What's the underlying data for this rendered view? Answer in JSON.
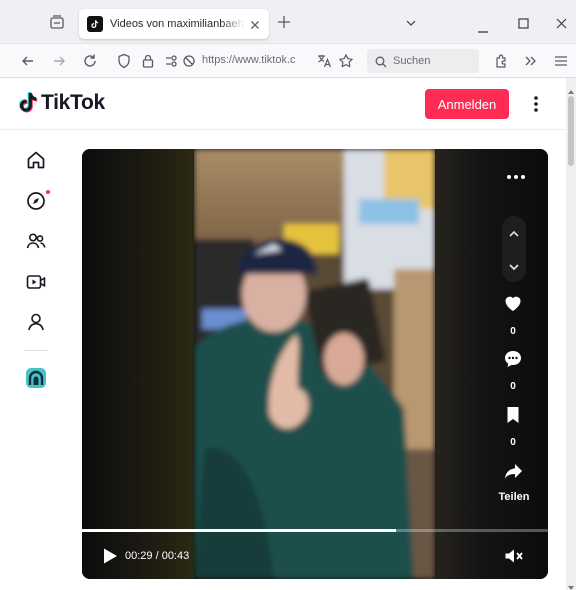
{
  "browser": {
    "tab": {
      "title": "Videos von maximilianbaehring"
    },
    "url": "https://www.tiktok.c",
    "search_placeholder": "Suchen"
  },
  "icons": {
    "tab_list": "tab-list-icon",
    "tab_close": "close-icon",
    "new_tab": "plus-icon",
    "minimize": "minimize-icon",
    "maximize": "maximize-icon",
    "window_close": "window-close-icon",
    "back": "arrow-left-icon",
    "forward": "arrow-right-icon",
    "reload": "reload-icon",
    "tracking_protection": "shield-icon",
    "lock": "lock-icon",
    "permissions": "permissions-icon",
    "translate": "translate-icon",
    "bookmark_star": "star-icon",
    "search": "search-icon",
    "extensions": "puzzle-icon",
    "overflow": "chevrons-right-icon",
    "menu": "hamburger-icon"
  },
  "tiktok": {
    "logo_text": "TikTok",
    "login_label": "Anmelden",
    "brand_colors": {
      "accent": "#fe2c55",
      "cyan": "#25f4ee"
    },
    "sidebar": [
      {
        "id": "home",
        "icon": "home-icon"
      },
      {
        "id": "explore",
        "icon": "compass-icon",
        "has_notification_dot": true
      },
      {
        "id": "following",
        "icon": "users-icon"
      },
      {
        "id": "live",
        "icon": "live-video-icon"
      },
      {
        "id": "profile",
        "icon": "user-icon"
      },
      {
        "id": "avatar",
        "icon": "creator-avatar-icon"
      }
    ],
    "video": {
      "actions": {
        "like_count": "0",
        "comment_count": "0",
        "save_count": "0",
        "share_label": "Teilen"
      },
      "time_current": "00:29",
      "time_total": "00:43",
      "time_display": "00:29 / 00:43",
      "progress_fraction": 0.674,
      "muted": true
    }
  }
}
